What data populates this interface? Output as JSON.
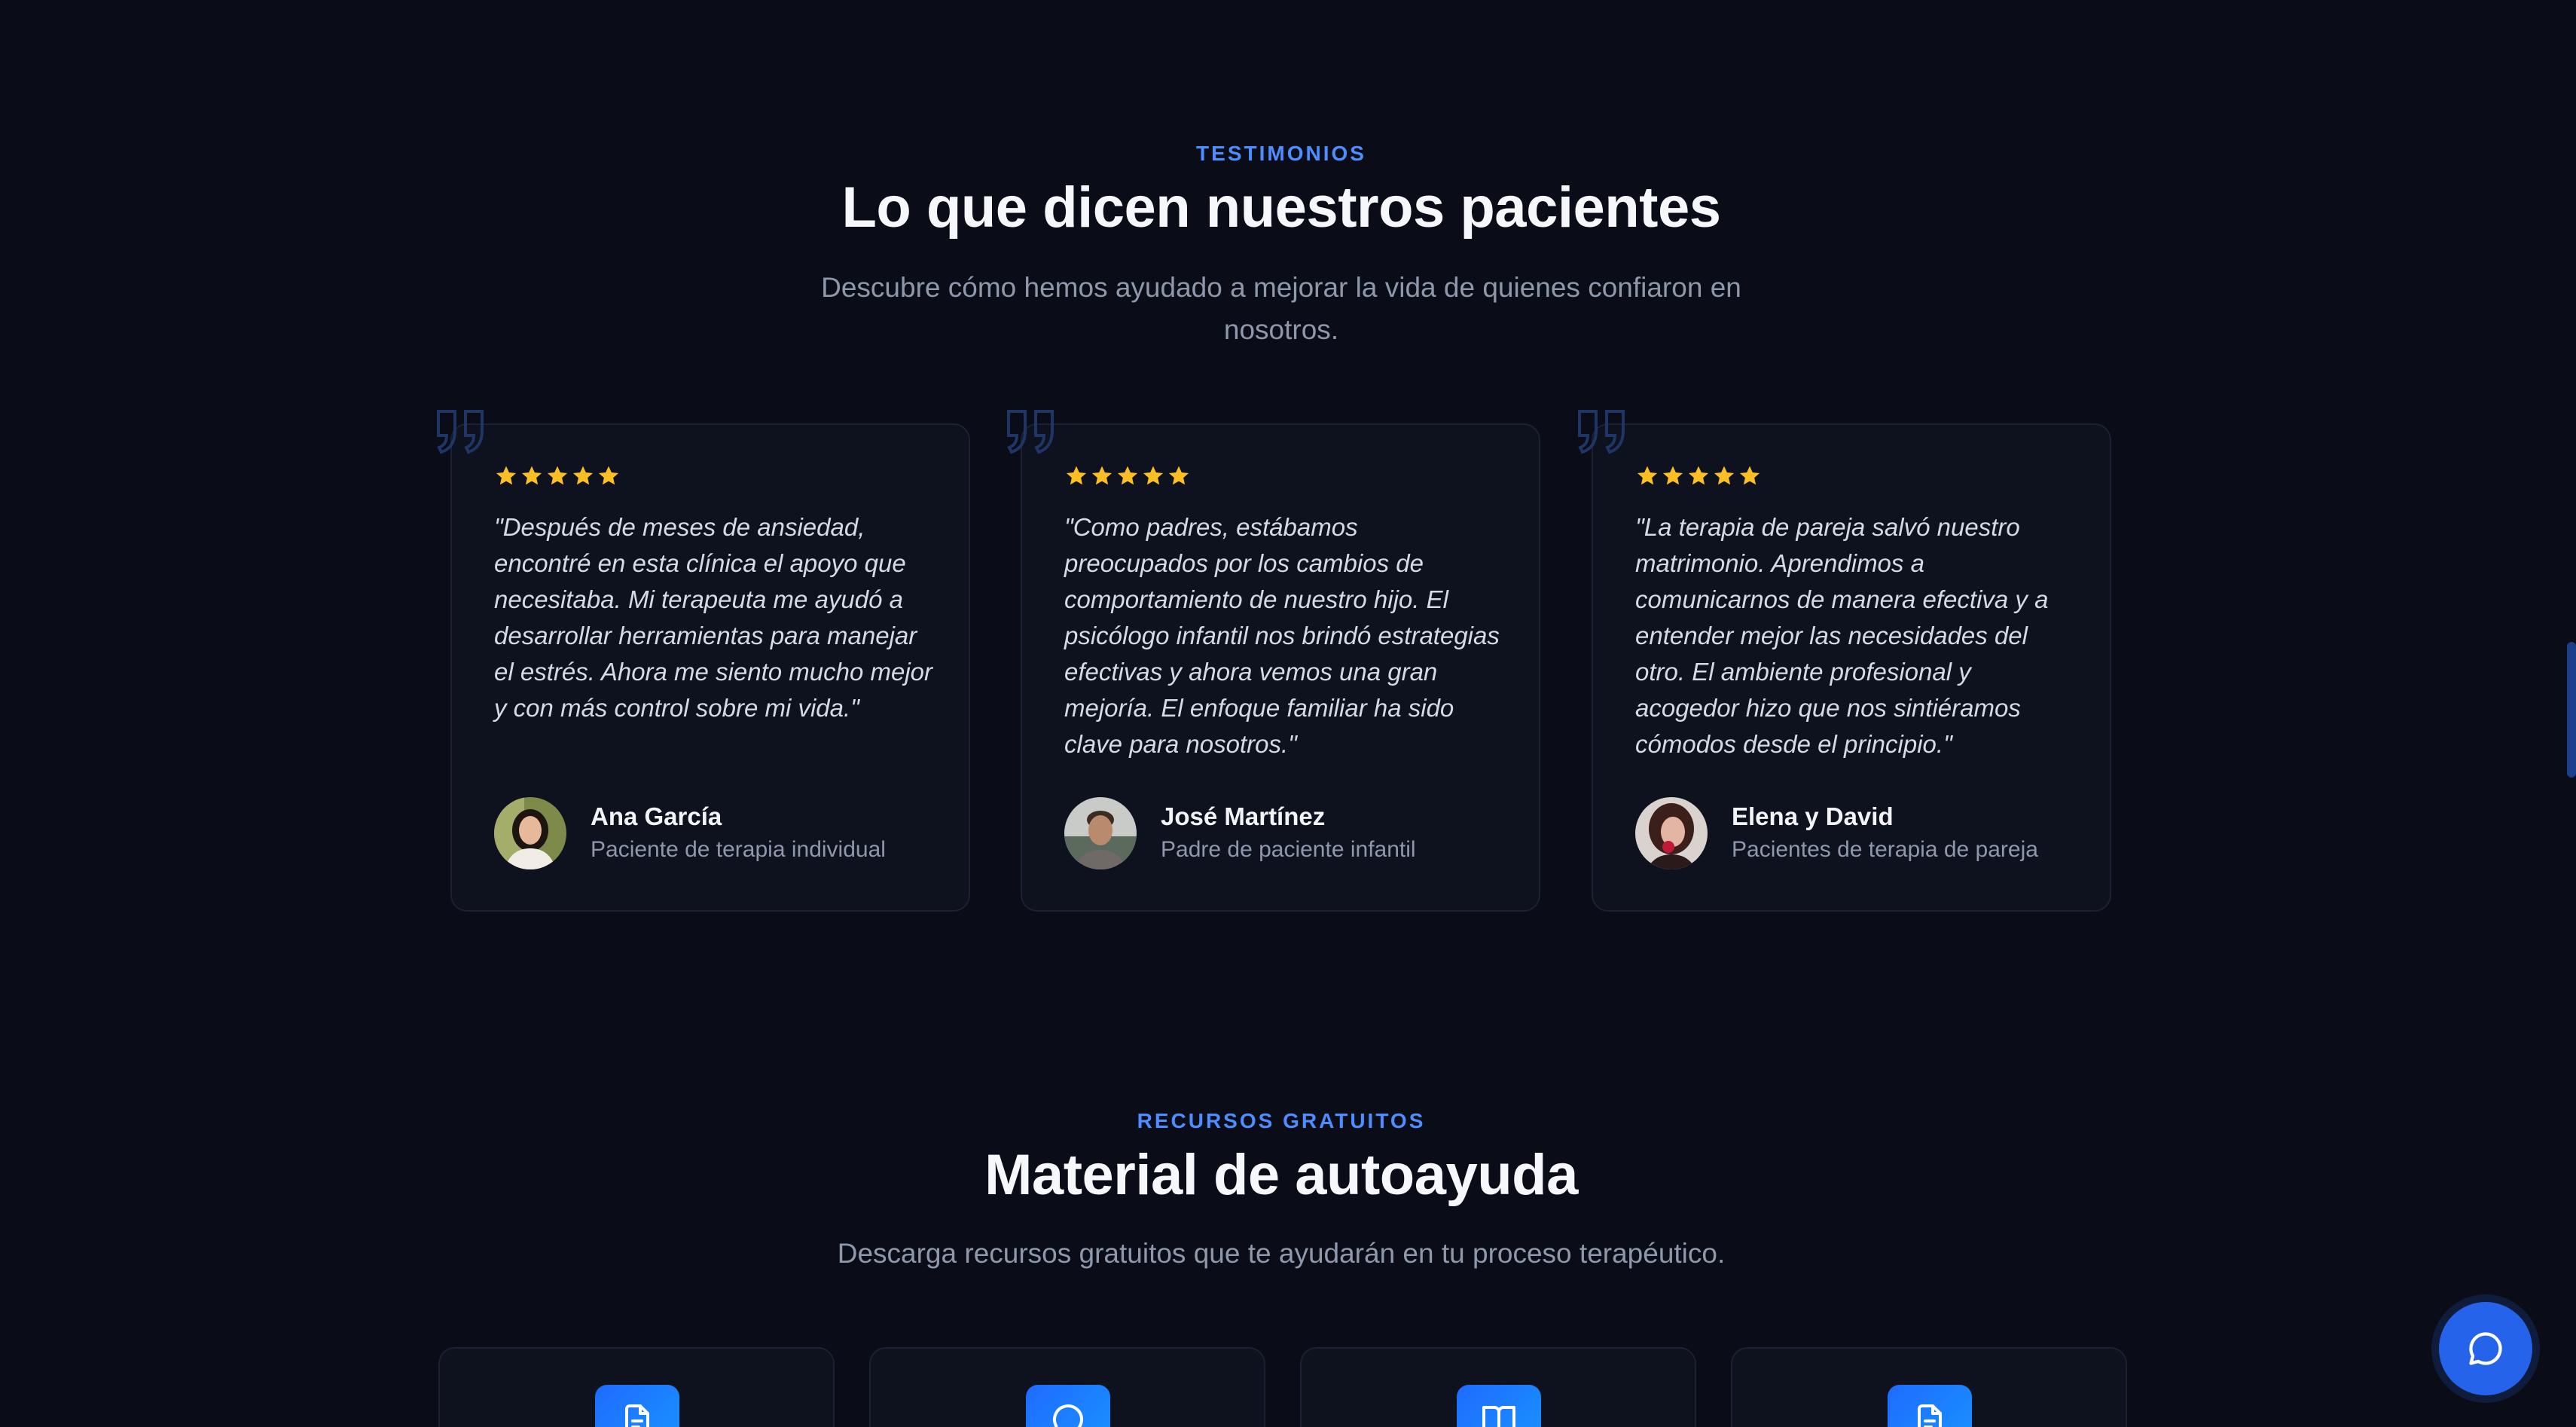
{
  "testimonials": {
    "eyebrow": "TESTIMONIOS",
    "title": "Lo que dicen nuestros pacientes",
    "subtitle": "Descubre cómo hemos ayudado a mejorar la vida de quienes confiaron en nosotros.",
    "items": [
      {
        "rating": 5,
        "quote": "\"Después de meses de ansiedad, encontré en esta clínica el apoyo que necesitaba. Mi terapeuta me ayudó a desarrollar herramientas para manejar el estrés. Ahora me siento mucho mejor y con más control sobre mi vida.\"",
        "name": "Ana García",
        "role": "Paciente de terapia individual"
      },
      {
        "rating": 5,
        "quote": "\"Como padres, estábamos preocupados por los cambios de comportamiento de nuestro hijo. El psicólogo infantil nos brindó estrategias efectivas y ahora vemos una gran mejoría. El enfoque familiar ha sido clave para nosotros.\"",
        "name": "José Martínez",
        "role": "Padre de paciente infantil"
      },
      {
        "rating": 5,
        "quote": "\"La terapia de pareja salvó nuestro matrimonio. Aprendimos a comunicarnos de manera efectiva y a entender mejor las necesidades del otro. El ambiente profesional y acogedor hizo que nos sintiéramos cómodos desde el principio.\"",
        "name": "Elena y David",
        "role": "Pacientes de terapia de pareja"
      }
    ]
  },
  "resources": {
    "eyebrow": "RECURSOS GRATUITOS",
    "title": "Material de autoayuda",
    "subtitle": "Descarga recursos gratuitos que te ayudarán en tu proceso terapéutico.",
    "icons": [
      "document-icon",
      "chat-bubble-icon",
      "book-icon",
      "document-icon"
    ]
  },
  "colors": {
    "background": "#0a0d17",
    "accent": "#4c8dff",
    "star": "#fbbf24",
    "button": "#2563eb"
  },
  "chat": {
    "icon": "chat-bubble-icon"
  }
}
